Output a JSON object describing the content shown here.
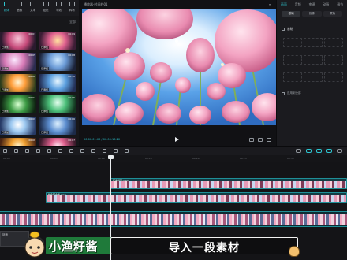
{
  "toolbar": {
    "items": [
      {
        "label": "媒体",
        "icon": "media-icon"
      },
      {
        "label": "音频",
        "icon": "audio-icon"
      },
      {
        "label": "文本",
        "icon": "text-icon"
      },
      {
        "label": "贴纸",
        "icon": "sticker-icon"
      },
      {
        "label": "特效",
        "icon": "effects-icon"
      },
      {
        "label": "转场",
        "icon": "transition-icon"
      }
    ]
  },
  "media": {
    "filter": "全部",
    "thumbs": [
      {
        "tag": "已添加",
        "dur": "00:07"
      },
      {
        "tag": "已添加",
        "dur": "00:09"
      },
      {
        "tag": "已添加",
        "dur": "00:05"
      },
      {
        "tag": "已添加",
        "dur": "00:08"
      },
      {
        "tag": "已添加",
        "dur": "00:06"
      },
      {
        "tag": "已添加",
        "dur": "00:10"
      },
      {
        "tag": "已添加",
        "dur": "00:07"
      },
      {
        "tag": "已添加",
        "dur": "00:05"
      },
      {
        "tag": "已添加",
        "dur": "00:09"
      },
      {
        "tag": "已添加",
        "dur": "00:06"
      },
      {
        "tag": "已添加",
        "dur": "00:08"
      },
      {
        "tag": "已添加",
        "dur": "00:07"
      }
    ]
  },
  "player": {
    "title": "播放器-时间线01",
    "timecode": "00:00:01:00 / 00:00:18:20"
  },
  "inspector": {
    "tabs": [
      "画面",
      "音频",
      "变速",
      "动画",
      "调节"
    ],
    "subtabs": [
      "基础",
      "抠像",
      "蒙版"
    ],
    "section_label": "基础",
    "option_label": "应用到全部"
  },
  "timeline": {
    "ruler": [
      "00:00",
      "00:05",
      "00:10",
      "00:15",
      "00:20",
      "00:25",
      "00:30"
    ],
    "clip_top_name": "花朵特写.mp4",
    "clip_mid_name": "粉色郁金香.mp4",
    "cover_label": "封面"
  },
  "banner": {
    "brand": "小渔籽酱",
    "caption": "导入一段素材"
  },
  "colors": {
    "accent": "#2ec5cf",
    "banner_green": "#1f7a3a"
  }
}
